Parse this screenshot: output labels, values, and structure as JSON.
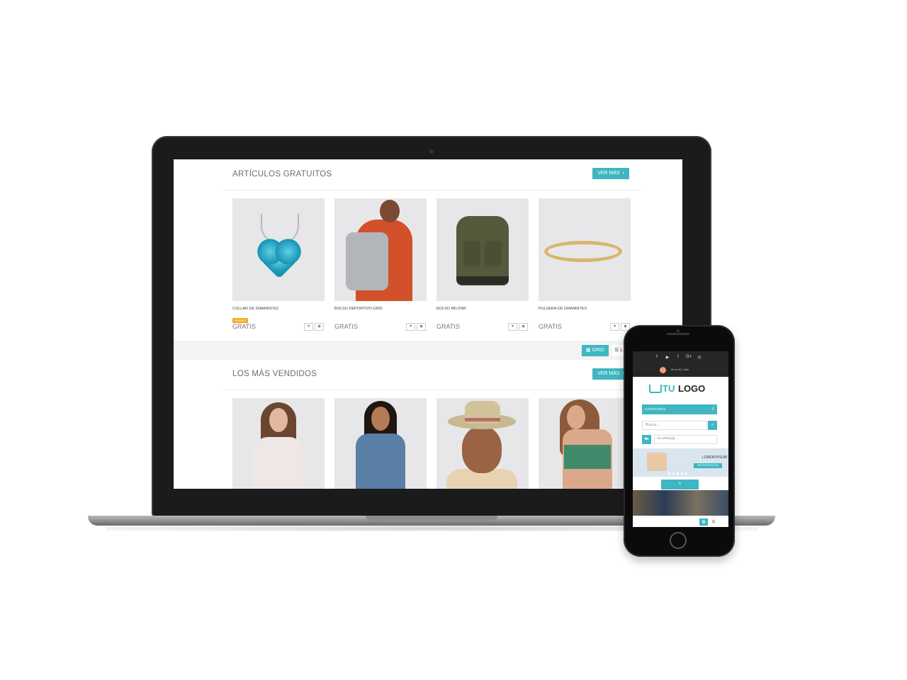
{
  "laptop_screen": {
    "free_section": {
      "title": "ARTÍCULOS GRATUITOS",
      "ver_mas": "VER MÁS",
      "products": [
        {
          "name": "COLLAR DE DIAMANTES",
          "badge": "NUEVO",
          "price": "GRATIS"
        },
        {
          "name": "BOLSO DEPORTIVO GRIS",
          "price": "GRATIS"
        },
        {
          "name": "BOLSO MILITAR",
          "price": "GRATIS"
        },
        {
          "name": "PULSERA DE DIAMANTES",
          "price": "GRATIS"
        }
      ]
    },
    "view_toggle": {
      "grid_label": "GRID",
      "list_label": "L"
    },
    "bestsellers_section": {
      "title": "LOS MÁS VENDIDOS",
      "ver_mas": "VER MÁS"
    }
  },
  "phone_screen": {
    "social_icons": [
      "f",
      "▶",
      "t",
      "G+",
      "◎"
    ],
    "profile_text": "Mi perfil  |  Salir",
    "logo": {
      "part1": "TU",
      "part2": "LOGO"
    },
    "categories_label": "CATEGORÍAS",
    "search_placeholder": "Buscar...",
    "cart_text": "TU CESTA (0)",
    "banner": {
      "title": "LOREM IPSUM",
      "button": "VER PRODUCTOS"
    }
  },
  "colors": {
    "accent": "#3fb6c1",
    "badge": "#f5a623"
  },
  "icons": {
    "chevron": "chevron-right-icon",
    "heart": "heart-icon",
    "diamond": "diamond-icon"
  }
}
